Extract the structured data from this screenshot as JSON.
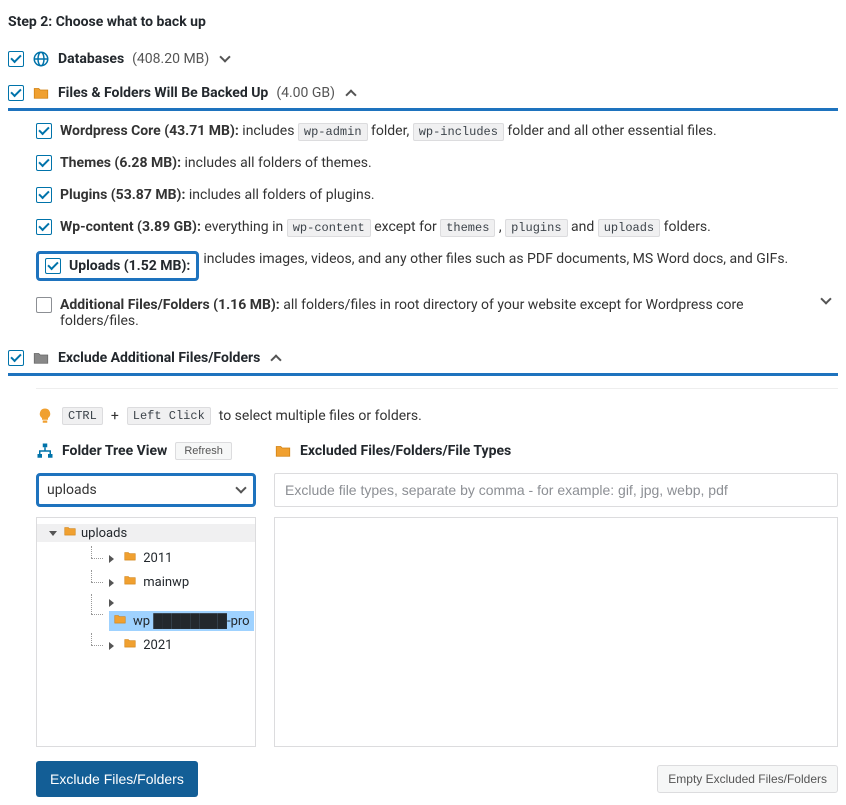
{
  "step_title": "Step 2: Choose what to back up",
  "databases": {
    "label": "Databases",
    "size": "(408.20 MB)"
  },
  "files_section": {
    "label": "Files & Folders Will Be Backed Up",
    "size": "(4.00 GB)"
  },
  "items": {
    "wp_core": {
      "title": "Wordpress Core (43.71 MB):",
      "desc_before": " includes ",
      "code1": "wp-admin",
      "desc_mid": " folder, ",
      "code2": "wp-includes",
      "desc_after": " folder and all other essential files."
    },
    "themes": {
      "title": "Themes (6.28 MB):",
      "desc": " includes all folders of themes."
    },
    "plugins": {
      "title": "Plugins (53.87 MB):",
      "desc": " includes all folders of plugins."
    },
    "wp_content": {
      "title": "Wp-content (3.89 GB):",
      "d1": " everything in ",
      "c1": "wp-content",
      "d2": " except for ",
      "c2": "themes",
      "d3": " , ",
      "c3": "plugins",
      "d4": " and ",
      "c4": "uploads",
      "d5": " folders."
    },
    "uploads": {
      "title": "Uploads (1.52 MB):",
      "desc": " includes images, videos, and any other files such as PDF documents, MS Word docs, and GIFs."
    },
    "additional": {
      "title": "Additional Files/Folders (1.16 MB):",
      "desc": " all folders/files in root directory of your website except for Wordpress core folders/files."
    }
  },
  "exclude_section": {
    "label": "Exclude Additional Files/Folders"
  },
  "hint": {
    "code1": "CTRL",
    "plus": "+",
    "code2": "Left Click",
    "text": " to select multiple files or folders."
  },
  "tree_header": "Folder Tree View",
  "refresh": "Refresh",
  "excluded_header": "Excluded Files/Folders/File Types",
  "select_value": "uploads",
  "exclude_placeholder": "Exclude file types, separate by comma - for example: gif, jpg, webp, pdf",
  "tree": {
    "root": "uploads",
    "children": [
      "2011",
      "mainwp",
      "wp ████████-pro",
      "2021"
    ],
    "selected_index": 2
  },
  "btn_exclude": "Exclude Files/Folders",
  "btn_empty": "Empty Excluded Files/Folders"
}
